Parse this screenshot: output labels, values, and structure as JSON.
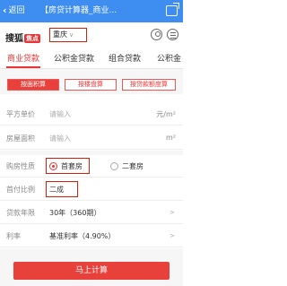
{
  "topbar": {
    "back_label": "返回",
    "title": "【房贷计算器_商业..."
  },
  "header": {
    "logo_text": "搜狐",
    "logo_badge": "焦点",
    "city": "重庆"
  },
  "tabs": [
    {
      "label": "商业贷款",
      "active": true
    },
    {
      "label": "公积金贷款",
      "active": false
    },
    {
      "label": "组合贷款",
      "active": false
    },
    {
      "label": "公积金",
      "active": false
    }
  ],
  "subtabs": [
    {
      "label": "按面积算",
      "active": true
    },
    {
      "label": "按楼盘算",
      "active": false
    },
    {
      "label": "按贷款额度算",
      "active": false
    }
  ],
  "form": {
    "unit_price": {
      "label": "平方单价",
      "placeholder": "请输入",
      "unit": "元/m²"
    },
    "area": {
      "label": "房屋面积",
      "placeholder": "请输入",
      "unit": "m²"
    },
    "nature": {
      "label": "购房性质",
      "option1": "首套房",
      "option2": "二套房"
    },
    "down_payment": {
      "label": "首付比例",
      "value": "二成"
    },
    "years": {
      "label": "贷款年限",
      "value": "30年（360期）"
    },
    "rate": {
      "label": "利率",
      "value": "基准利率（4.90%）"
    }
  },
  "submit_label": "马上计算"
}
